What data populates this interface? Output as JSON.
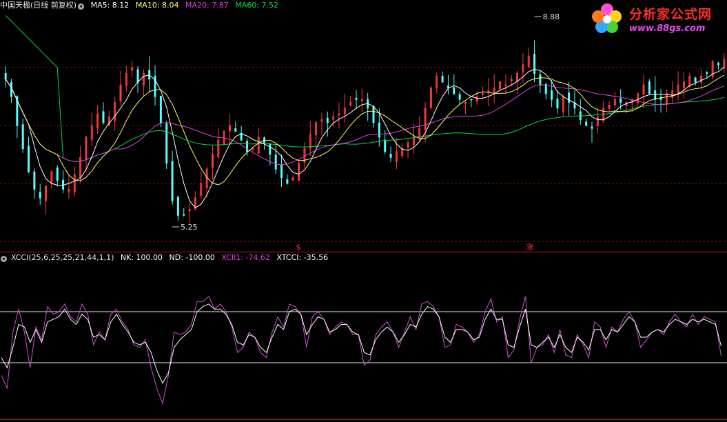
{
  "header": {
    "stock": "中国天楹(日线 前复权)",
    "ma5": "MA5: 8.12",
    "ma10": "MA10: 8.04",
    "ma20": "MA20: 7.87",
    "ma60": "MA60: 7.52"
  },
  "indicator": {
    "name": "XCCI(25,6,25,25,21,44,1,1)",
    "nk": "NK: 100.00",
    "nd": "ND: -100.00",
    "xcci1": "XCII1: -74.62",
    "xtcci": "XTCCI: -35.56"
  },
  "logo": {
    "title": "分析家公式网",
    "url": "www.88gs.com"
  },
  "colors": {
    "up": "#ff3c3c",
    "down": "#54ffff",
    "ma5": "#ffffff",
    "ma10": "#ffff66",
    "ma20": "#e040e0",
    "ma60": "#00e040",
    "grid": "#7a1010",
    "xcci1": "#d050d0",
    "xtcci": "#ffffff"
  },
  "chart_data": [
    {
      "type": "candlestick",
      "title": "中国天楹(日线 前复权)",
      "ylim": [
        5.0,
        9.0
      ],
      "annotations": [
        {
          "label": "8.88",
          "value": 8.88,
          "kind": "high",
          "index": 92
        },
        {
          "label": "5.25",
          "value": 5.25,
          "kind": "low",
          "index": 29
        }
      ],
      "signals": [
        {
          "label": "$",
          "index": 51
        },
        {
          "label": "涨",
          "index": 91
        }
      ],
      "close": [
        7.8,
        7.5,
        7.0,
        6.6,
        6.2,
        5.9,
        5.75,
        5.95,
        6.2,
        6.05,
        5.9,
        5.9,
        6.15,
        6.45,
        6.8,
        7.0,
        7.2,
        7.05,
        7.15,
        7.4,
        7.7,
        7.9,
        8.0,
        7.75,
        7.9,
        7.8,
        7.5,
        7.05,
        6.35,
        5.7,
        5.45,
        5.45,
        5.55,
        5.75,
        6.0,
        6.25,
        6.5,
        6.75,
        6.9,
        7.0,
        6.9,
        6.75,
        6.55,
        6.6,
        6.8,
        6.7,
        6.5,
        6.25,
        6.1,
        6.0,
        6.1,
        6.35,
        6.6,
        6.85,
        7.05,
        7.1,
        7.05,
        7.15,
        7.2,
        7.3,
        7.4,
        7.45,
        7.45,
        7.3,
        7.05,
        6.8,
        6.55,
        6.45,
        6.55,
        6.6,
        6.7,
        6.8,
        6.95,
        7.3,
        7.65,
        7.85,
        7.75,
        7.65,
        7.55,
        7.45,
        7.4,
        7.45,
        7.5,
        7.55,
        7.6,
        7.65,
        7.75,
        7.7,
        7.8,
        7.9,
        8.05,
        8.2,
        7.9,
        7.7,
        7.55,
        7.45,
        7.3,
        7.5,
        7.4,
        7.3,
        7.1,
        7.0,
        6.95,
        7.15,
        7.3,
        7.35,
        7.45,
        7.4,
        7.4,
        7.45,
        7.55,
        7.7,
        7.55,
        7.45,
        7.45,
        7.55,
        7.6,
        7.7,
        7.75,
        7.85,
        7.75,
        7.85,
        7.9,
        8.1,
        8.05,
        8.15
      ],
      "ma60": [
        7.52
      ]
    },
    {
      "type": "line",
      "title": "XCCI(25,6,25,25,21,44,1,1)",
      "ylim": [
        -300,
        300
      ],
      "reference_lines": [
        100,
        -100
      ],
      "series": [
        {
          "name": "XCII1",
          "values": [
            -150,
            -200,
            20,
            110,
            20,
            -120,
            40,
            -10,
            120,
            90,
            100,
            130,
            80,
            60,
            130,
            90,
            -30,
            20,
            -10,
            90,
            110,
            60,
            30,
            -30,
            -40,
            -10,
            -120,
            -200,
            -260,
            -150,
            20,
            10,
            20,
            50,
            140,
            140,
            160,
            110,
            130,
            100,
            40,
            -60,
            -40,
            20,
            0,
            -60,
            -80,
            20,
            80,
            40,
            130,
            120,
            90,
            -40,
            80,
            100,
            70,
            10,
            40,
            60,
            50,
            10,
            10,
            -110,
            -90,
            10,
            40,
            60,
            20,
            -40,
            20,
            80,
            30,
            130,
            140,
            120,
            80,
            -40,
            -30,
            50,
            40,
            20,
            -20,
            10,
            100,
            150,
            60,
            80,
            -80,
            -50,
            70,
            160,
            -100,
            -40,
            -30,
            10,
            -60,
            30,
            -70,
            -80,
            10,
            -30,
            -80,
            60,
            40,
            -40,
            40,
            20,
            70,
            100,
            60,
            -40,
            -10,
            20,
            30,
            10,
            60,
            90,
            60,
            40,
            90,
            50,
            80,
            70,
            60,
            -74.62
          ]
        },
        {
          "name": "XTCCI",
          "values": [
            -80,
            -120,
            -40,
            50,
            40,
            -20,
            30,
            -20,
            60,
            70,
            80,
            110,
            70,
            50,
            90,
            70,
            0,
            10,
            -10,
            60,
            90,
            50,
            20,
            -20,
            -30,
            -20,
            -60,
            -130,
            -180,
            -140,
            -40,
            -10,
            10,
            30,
            100,
            120,
            130,
            110,
            110,
            90,
            50,
            -20,
            -30,
            10,
            0,
            -40,
            -60,
            0,
            50,
            30,
            100,
            110,
            90,
            10,
            50,
            80,
            70,
            20,
            30,
            50,
            50,
            20,
            10,
            -60,
            -70,
            -10,
            20,
            40,
            20,
            -20,
            10,
            50,
            40,
            90,
            120,
            110,
            80,
            0,
            -20,
            30,
            30,
            20,
            -10,
            0,
            70,
            110,
            70,
            70,
            -30,
            -40,
            40,
            110,
            -30,
            -40,
            -20,
            0,
            -40,
            10,
            -40,
            -60,
            0,
            -20,
            -50,
            30,
            30,
            -10,
            30,
            20,
            50,
            80,
            60,
            0,
            0,
            20,
            30,
            20,
            50,
            70,
            60,
            50,
            70,
            60,
            70,
            60,
            50,
            -35.56
          ]
        }
      ]
    }
  ]
}
